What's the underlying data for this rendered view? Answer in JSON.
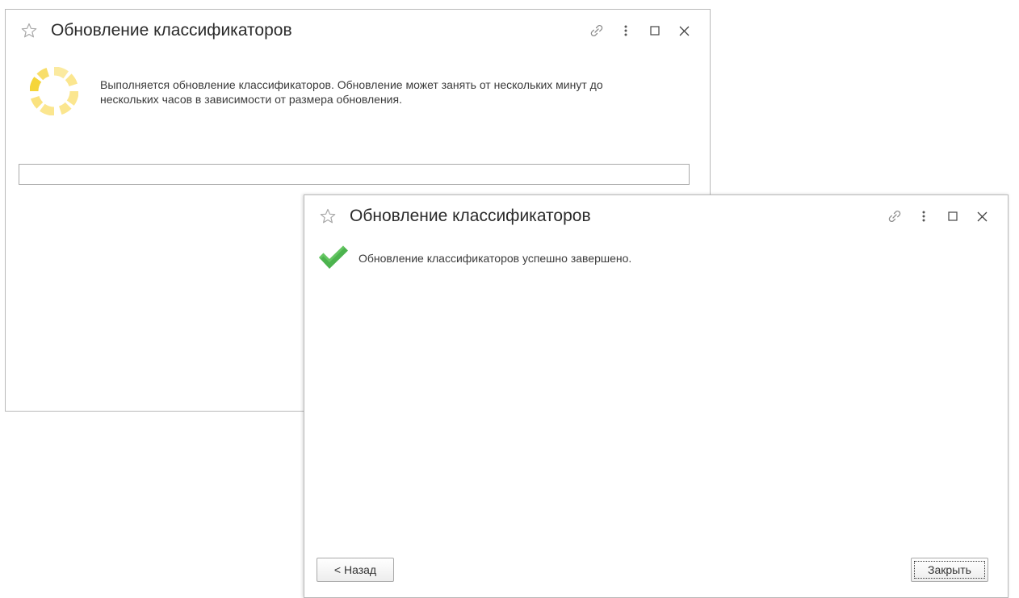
{
  "background_window": {
    "title": "Обновление классификаторов",
    "message": "Выполняется обновление классификаторов. Обновление может занять от нескольких минут до нескольких часов в зависимости от размера обновления.",
    "progress_percent": 0,
    "icons": {
      "favorite": "star-icon",
      "link": "link-icon",
      "more": "more-icon",
      "maximize": "maximize-icon",
      "close": "close-icon",
      "status": "spinner-icon"
    },
    "spinner_color": "#f5d53a"
  },
  "foreground_window": {
    "title": "Обновление классификаторов",
    "message": "Обновление классификаторов успешно завершено.",
    "back_button": "< Назад",
    "close_button": "Закрыть",
    "icons": {
      "favorite": "star-icon",
      "link": "link-icon",
      "more": "more-icon",
      "maximize": "maximize-icon",
      "close": "close-icon",
      "status": "check-icon"
    },
    "check_color": "#4cb34e"
  }
}
